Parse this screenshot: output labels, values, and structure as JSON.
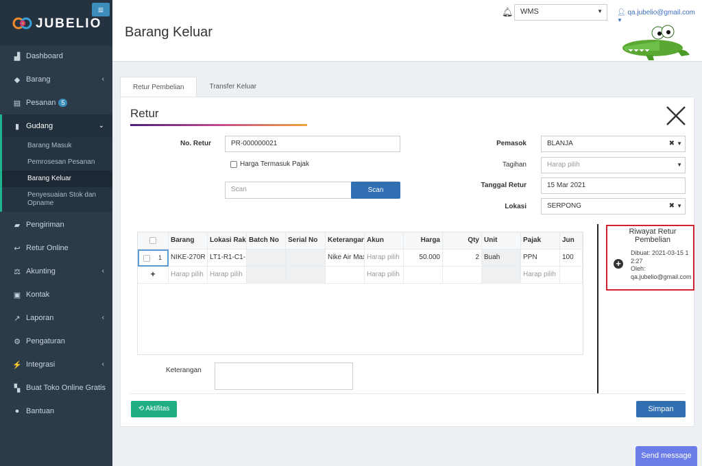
{
  "brand": {
    "name": "JUBELIO"
  },
  "sidebar": {
    "items": [
      {
        "label": "Dashboard",
        "icon": "chart-area-icon"
      },
      {
        "label": "Barang",
        "icon": "cubes-icon"
      },
      {
        "label": "Pesanan",
        "icon": "basket-icon",
        "badge": "5"
      },
      {
        "label": "Gudang",
        "icon": "warehouse-icon"
      },
      {
        "label": "Pengiriman",
        "icon": "truck-icon"
      },
      {
        "label": "Retur Online",
        "icon": "reply-icon"
      },
      {
        "label": "Akunting",
        "icon": "balance-scale-icon"
      },
      {
        "label": "Kontak",
        "icon": "address-card-icon"
      },
      {
        "label": "Laporan",
        "icon": "line-chart-icon"
      },
      {
        "label": "Pengaturan",
        "icon": "cogs-icon"
      },
      {
        "label": "Integrasi",
        "icon": "plug-icon"
      },
      {
        "label": "Buat Toko Online Gratis",
        "icon": "cart-icon"
      },
      {
        "label": "Bantuan",
        "icon": "question-circle-icon"
      }
    ],
    "gudang_sub": [
      {
        "label": "Barang Masuk"
      },
      {
        "label": "Pemrosesan Pesanan"
      },
      {
        "label": "Barang Keluar"
      },
      {
        "label": "Penyesuaian Stok dan Opname"
      }
    ]
  },
  "header": {
    "page_title": "Barang Keluar",
    "location_select": "WMS",
    "user_email": "qa.jubelio@gmail.com"
  },
  "tabs": [
    {
      "label": "Retur Pembelian"
    },
    {
      "label": "Transfer Keluar"
    }
  ],
  "form": {
    "title": "Retur",
    "no_retur_label": "No. Retur",
    "no_retur_value": "PR-000000021",
    "harga_pajak_label": "Harga Termasuk Pajak",
    "scan_placeholder": "Scan",
    "scan_button": "Scan",
    "pemasok_label": "Pemasok",
    "pemasok_value": "BLANJA",
    "tagihan_label": "Tagihan",
    "tagihan_placeholder": "Harap pilih",
    "tanggal_label": "Tanggal Retur",
    "tanggal_value": "15 Mar 2021",
    "lokasi_label": "Lokasi",
    "lokasi_value": "SERPONG",
    "keterangan_label": "Keterangan",
    "aktifitas_button": "Aktifitas",
    "simpan_button": "Simpan"
  },
  "table": {
    "headers": [
      "Barang",
      "Lokasi Rak",
      "Batch No",
      "Serial No",
      "Keterangan",
      "Akun",
      "Harga",
      "Qty",
      "Unit",
      "Pajak",
      "Jun"
    ],
    "row": {
      "num": "1",
      "barang": "NIKE-270R",
      "lokasi": "LT1-R1-C1-...",
      "keterangan": "Nike Air Max",
      "akun": "Harap pilih",
      "harga": "50.000",
      "qty": "2",
      "unit": "Buah",
      "pajak": "PPN",
      "jumlah": "100"
    },
    "add_row": {
      "plus": "+",
      "barang": "Harap pilih",
      "lokasi": "Harap pilih",
      "akun": "Harap pilih",
      "pajak": "Harap pilih"
    }
  },
  "history": {
    "title": "Riwayat Retur Pembelian",
    "created": "Dibuat: 2021-03-15 12:27",
    "by_label": "Oleh:",
    "by_value": "qa.jubelio@gmail.com"
  },
  "send_message": "Send message"
}
